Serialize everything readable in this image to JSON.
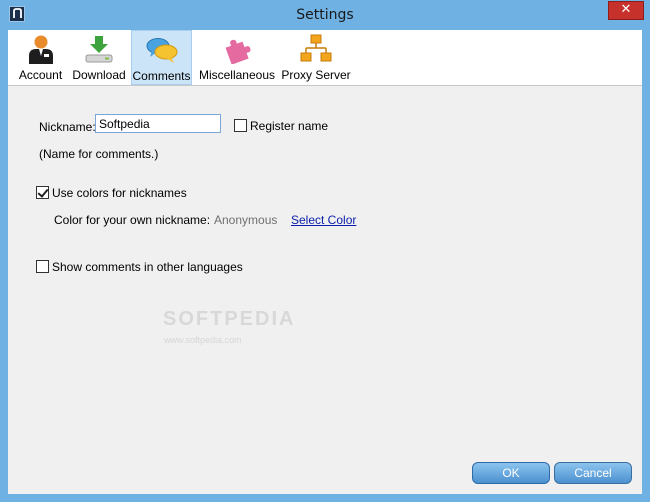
{
  "window": {
    "title": "Settings",
    "close_glyph": "✕"
  },
  "toolbar": {
    "items": [
      {
        "label": "Account",
        "icon": "account-icon",
        "active": false
      },
      {
        "label": "Download",
        "icon": "download-icon",
        "active": false
      },
      {
        "label": "Comments",
        "icon": "comments-icon",
        "active": true
      },
      {
        "label": "Miscellaneous",
        "icon": "puzzle-icon",
        "active": false
      },
      {
        "label": "Proxy Server",
        "icon": "network-icon",
        "active": false
      }
    ]
  },
  "comments": {
    "nickname_label": "Nickname:",
    "nickname_value": "Softpedia",
    "register_label": "Register name",
    "register_checked": false,
    "hint": "(Name for comments.)",
    "use_colors_label": "Use colors for nicknames",
    "use_colors_checked": true,
    "own_color_label": "Color for your own nickname:",
    "own_color_preview": "Anonymous",
    "select_color_link": "Select Color",
    "other_lang_label": "Show comments in other languages",
    "other_lang_checked": false
  },
  "watermark": {
    "text": "SOFTPEDIA",
    "sub": "www.softpedia.com"
  },
  "buttons": {
    "ok": "OK",
    "cancel": "Cancel"
  },
  "colors": {
    "titlebar": "#6fb1e2",
    "close": "#c7312b",
    "active_tab": "#cce4f7",
    "link": "#0b1da8"
  }
}
